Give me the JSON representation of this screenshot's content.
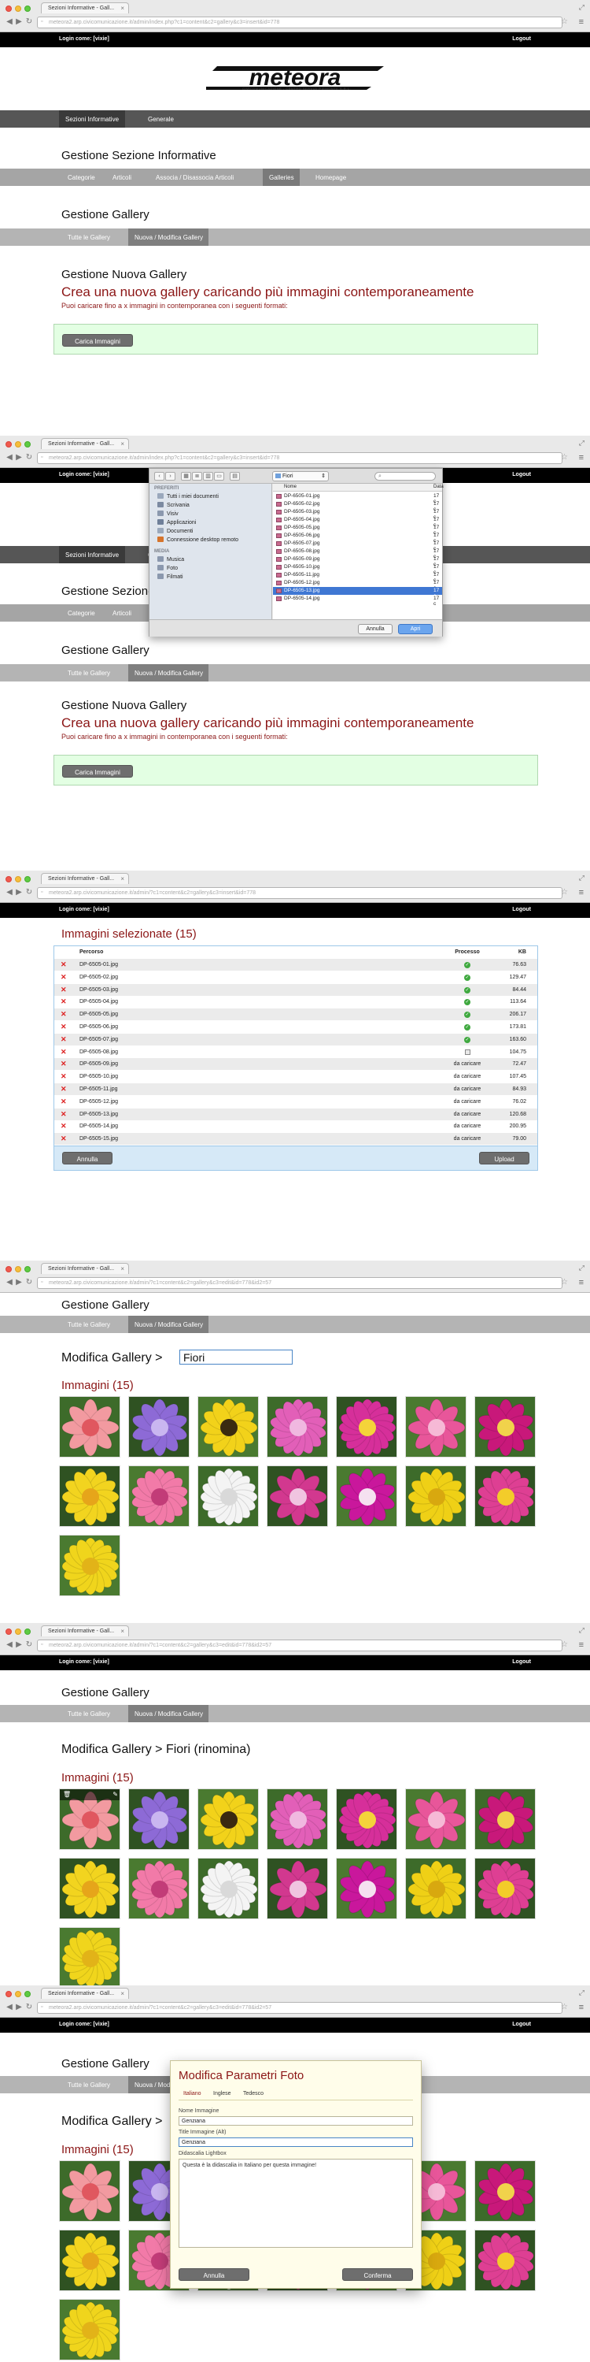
{
  "browser": {
    "tab_title": "Sezioni Informative - Gall...",
    "tab_close": "×",
    "url_panel1": "meteora2.arp.civicomunicazione.it/admin/index.php?c1=content&c2=gallery&c3=insert&id=778",
    "url_panel2": "meteora2.arp.civicomunicazione.it/admin/index.php?c1=content&c2=gallery&c3=insert&id=778",
    "url_panel3": "meteora2.arp.civicomunicazione.it/admin/?c1=content&c2=gallery&c3=insert&id=778",
    "url_panel4": "meteora2.arp.civicomunicazione.it/admin/?c1=content&c2=gallery&c3=edit&id=778&id2=57",
    "url_panel5": "meteora2.arp.civicomunicazione.it/admin/?c1=content&c2=gallery&c3=edit&id=778&id2=57",
    "url_panel6": "meteora2.arp.civicomunicazione.it/admin/?c1=content&c2=gallery&c3=edit&id=778&id2=57",
    "icons": {
      "back": "back-arrow-icon",
      "forward": "forward-arrow-icon",
      "reload": "reload-icon",
      "star": "star-icon",
      "menu": "hamburger-menu-icon",
      "resize": "resize-icon"
    }
  },
  "topbar": {
    "login_text": "Login come: [vixie]",
    "logout": "Logout"
  },
  "logo": {
    "text": "meteora",
    "tagline": "CIVICOMUNICAZIONE - CENTRO SERVIZI PIEMONTE S.R.L."
  },
  "nav": {
    "bar1": [
      "Sezioni Informative",
      "Generale"
    ],
    "section_title": "Gestione Sezione Informative",
    "bar2": [
      "Categorie",
      "Articoli",
      "Associa / Disassocia Articoli",
      "Galleries",
      "Homepage"
    ],
    "gallery_title": "Gestione Gallery",
    "bar3": [
      "Tutte le Gallery",
      "Nuova / Modifica Gallery"
    ]
  },
  "new_gallery": {
    "title": "Gestione Nuova Gallery",
    "headline": "Crea una nuova gallery caricando più immagini contemporaneamente",
    "subline": "Puoi caricare fino a x immagini in contemporanea con i seguenti formati:",
    "upload_button": "Carica Immagini"
  },
  "file_dialog": {
    "folder": "Fiori",
    "search_placeholder": "",
    "sidebar_headers": [
      "PREFERITI",
      "MEDIA"
    ],
    "favorites": [
      "Tutti i miei documenti",
      "Scrivania",
      "Visiv",
      "Applicazioni",
      "Documenti",
      "Connessione desktop remoto"
    ],
    "media": [
      "Musica",
      "Foto",
      "Filmati"
    ],
    "col_name": "Nome",
    "col_date": "Data",
    "files": [
      "DP-6505-01.jpg",
      "DP-6505-02.jpg",
      "DP-6505-03.jpg",
      "DP-6505-04.jpg",
      "DP-6505-05.jpg",
      "DP-6505-06.jpg",
      "DP-6505-07.jpg",
      "DP-6505-08.jpg",
      "DP-6505-09.jpg",
      "DP-6505-10.jpg",
      "DP-6505-11.jpg",
      "DP-6505-12.jpg",
      "DP-6505-13.jpg",
      "DP-6505-14.jpg"
    ],
    "date_stub": "17 c",
    "selected_index": 12,
    "cancel": "Annulla",
    "open": "Apri"
  },
  "selected_images": {
    "title": "Immagini selezionate (15)",
    "col_name": "Percorso",
    "col_status": "Processo",
    "col_kb": "KB",
    "rows": [
      {
        "name": "DP-6505-01.jpg",
        "status": "ok",
        "kb": "76.63"
      },
      {
        "name": "DP-6505-02.jpg",
        "status": "ok",
        "kb": "129.47"
      },
      {
        "name": "DP-6505-03.jpg",
        "status": "ok",
        "kb": "84.44"
      },
      {
        "name": "DP-6505-04.jpg",
        "status": "ok",
        "kb": "113.64"
      },
      {
        "name": "DP-6505-05.jpg",
        "status": "ok",
        "kb": "206.17"
      },
      {
        "name": "DP-6505-06.jpg",
        "status": "ok",
        "kb": "173.81"
      },
      {
        "name": "DP-6505-07.jpg",
        "status": "ok",
        "kb": "163.60"
      },
      {
        "name": "DP-6505-08.jpg",
        "status": "progress",
        "kb": "104.75"
      },
      {
        "name": "DP-6505-09.jpg",
        "status": "da caricare",
        "kb": "72.47"
      },
      {
        "name": "DP-6505-10.jpg",
        "status": "da caricare",
        "kb": "107.45"
      },
      {
        "name": "DP-6505-11.jpg",
        "status": "da caricare",
        "kb": "84.93"
      },
      {
        "name": "DP-6505-12.jpg",
        "status": "da caricare",
        "kb": "76.02"
      },
      {
        "name": "DP-6505-13.jpg",
        "status": "da caricare",
        "kb": "120.68"
      },
      {
        "name": "DP-6505-14.jpg",
        "status": "da caricare",
        "kb": "200.95"
      },
      {
        "name": "DP-6505-15.jpg",
        "status": "da caricare",
        "kb": "79.00"
      }
    ],
    "cancel": "Annulla",
    "upload": "Upload"
  },
  "edit_gallery": {
    "label": "Modifica Gallery >",
    "name_value": "Fiori",
    "title_renamed": "Modifica Gallery > Fiori (rinomina)",
    "images_title": "Immagini (15)"
  },
  "thumb_colors": [
    {
      "petal": "#f29aa0",
      "center": "#e0575f"
    },
    {
      "petal": "#8d6ad6",
      "center": "#c9b6f0"
    },
    {
      "petal": "#f2d21a",
      "center": "#3a2a10"
    },
    {
      "petal": "#e25fb8",
      "center": "#f0b8e0"
    },
    {
      "petal": "#d62f9a",
      "center": "#f4d33a"
    },
    {
      "petal": "#e8569a",
      "center": "#f6b9d6"
    },
    {
      "petal": "#c8187a",
      "center": "#f1d24b"
    },
    {
      "petal": "#f2d41f",
      "center": "#e6a51a"
    },
    {
      "petal": "#f27aa8",
      "center": "#c23c78"
    },
    {
      "petal": "#f4f4f4",
      "center": "#d9d9d9"
    },
    {
      "petal": "#d2388f",
      "center": "#f0c4e0"
    },
    {
      "petal": "#c9179c",
      "center": "#f5e1f0"
    },
    {
      "petal": "#efd016",
      "center": "#d8a80f"
    },
    {
      "petal": "#de3f93",
      "center": "#f3cc2a"
    },
    {
      "petal": "#f0d51c",
      "center": "#e2b318"
    }
  ],
  "thumb_tools": {
    "delete": "trash-icon",
    "edit": "pencil-icon"
  },
  "modal": {
    "title": "Modifica Parametri Foto",
    "tabs": [
      "Italiano",
      "Inglese",
      "Tedesco"
    ],
    "name_label": "Nome Immagine",
    "name_value": "Genziana",
    "alt_label": "Title Immagine (Alt)",
    "alt_value": "Genziana",
    "caption_label": "Didascalia Lightbox",
    "caption_value": "Questa è la didascalia in Italiano per questa immagine!",
    "cancel": "Annulla",
    "confirm": "Conferma"
  }
}
